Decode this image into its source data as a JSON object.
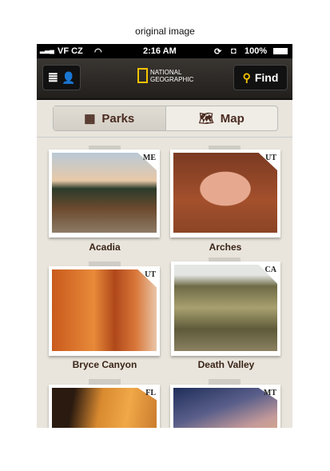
{
  "caption": "original image",
  "status": {
    "carrier": "VF CZ",
    "time": "2:16 AM",
    "battery": "100%"
  },
  "header": {
    "find_label": "Find",
    "logo_line1": "NATIONAL",
    "logo_line2": "GEOGRAPHIC"
  },
  "tabs": [
    {
      "label": "Parks",
      "selected": true
    },
    {
      "label": "Map",
      "selected": false
    }
  ],
  "parks": [
    {
      "name": "Acadia",
      "state": "ME"
    },
    {
      "name": "Arches",
      "state": "UT"
    },
    {
      "name": "Bryce Canyon",
      "state": "UT"
    },
    {
      "name": "Death Valley",
      "state": "CA"
    },
    {
      "name": "",
      "state": "FL"
    },
    {
      "name": "",
      "state": "MT"
    }
  ]
}
